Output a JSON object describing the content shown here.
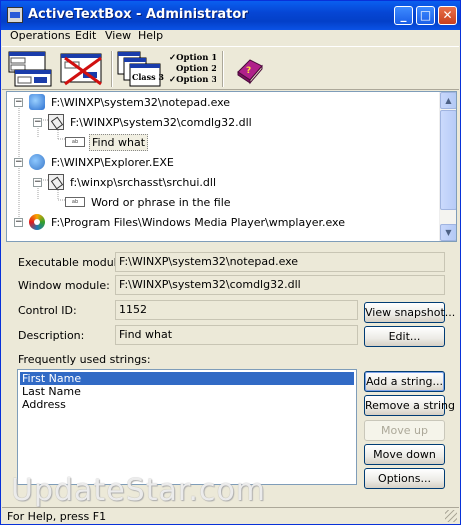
{
  "window": {
    "title": "ActiveTextBox - Administrator",
    "minimize_glyph": "_",
    "maximize_glyph": "□",
    "close_glyph": "✕"
  },
  "menu": {
    "items": [
      {
        "label": "Operations"
      },
      {
        "label": "Edit"
      },
      {
        "label": "View"
      },
      {
        "label": "Help"
      }
    ]
  },
  "toolbar": {
    "class_tool_label": "Class 3",
    "options_tool": [
      "✓Option 1",
      "Option 2",
      "✓Option 3"
    ],
    "icons": [
      "find-controls-icon",
      "delete-controls-icon",
      "class-view-icon",
      "options-icon",
      "help-book-icon"
    ]
  },
  "tree": {
    "items": [
      {
        "label": "F:\\WINXP\\system32\\notepad.exe",
        "icon": "exe-icon",
        "expander": "−"
      },
      {
        "label": "F:\\WINXP\\system32\\comdlg32.dll",
        "icon": "dialog-icon",
        "expander": "−"
      },
      {
        "label": "Find what",
        "icon": "control-icon",
        "selected": true
      },
      {
        "label": "F:\\WINXP\\Explorer.EXE",
        "icon": "explorer-icon",
        "expander": "−"
      },
      {
        "label": "f:\\winxp\\srchasst\\srchui.dll",
        "icon": "dialog-icon",
        "expander": "−"
      },
      {
        "label": "Word or phrase in the file",
        "icon": "control-icon"
      },
      {
        "label": "F:\\Program Files\\Windows Media Player\\wmplayer.exe",
        "icon": "media-player-icon",
        "expander": "−"
      }
    ]
  },
  "details": {
    "executable_label": "Executable module:",
    "executable_value": "F:\\WINXP\\system32\\notepad.exe",
    "window_label": "Window module:",
    "window_value": "F:\\WINXP\\system32\\comdlg32.dll",
    "control_id_label": "Control ID:",
    "control_id_value": "1152",
    "description_label": "Description:",
    "description_value": "Find what",
    "view_snapshot_label": "View snapshot...",
    "edit_label": "Edit..."
  },
  "strings": {
    "label": "Frequently used strings:",
    "items": [
      "First Name",
      "Last Name",
      "Address"
    ],
    "selected_index": 0,
    "add_label": "Add a string...",
    "remove_label": "Remove a string",
    "move_up_label": "Move up",
    "move_down_label": "Move down",
    "options_label": "Options..."
  },
  "watermark": "UpdateStar.com",
  "status": {
    "text": "For Help, press F1"
  }
}
